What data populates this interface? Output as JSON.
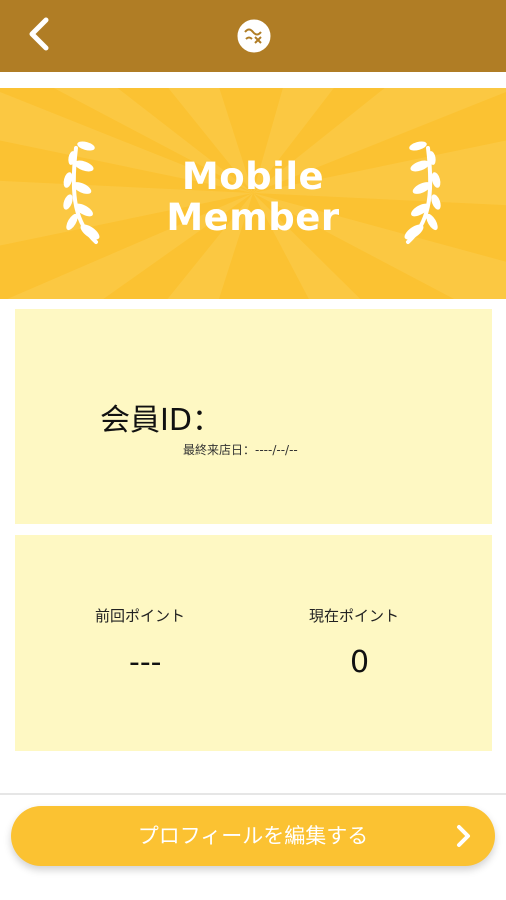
{
  "header": {
    "back_icon": "chevron-left-icon",
    "logo_icon": "brand-logo-icon",
    "background": "#b07d25"
  },
  "banner": {
    "title_line1": "Mobile",
    "title_line2": "Member",
    "laurel_icon": "laurel-icon",
    "background": "#fbc232"
  },
  "member": {
    "id_label": "会員ID：",
    "last_visit_label": "最終来店日：",
    "last_visit_value": "----/--/--"
  },
  "points": {
    "previous_label": "前回ポイント",
    "previous_value": "---",
    "current_label": "現在ポイント",
    "current_value": "0"
  },
  "actions": {
    "edit_profile_label": "プロフィールを編集する",
    "edit_chevron_icon": "chevron-right-icon"
  },
  "colors": {
    "accent": "#fbc232",
    "card": "#fef8c3",
    "header": "#b07d25"
  }
}
